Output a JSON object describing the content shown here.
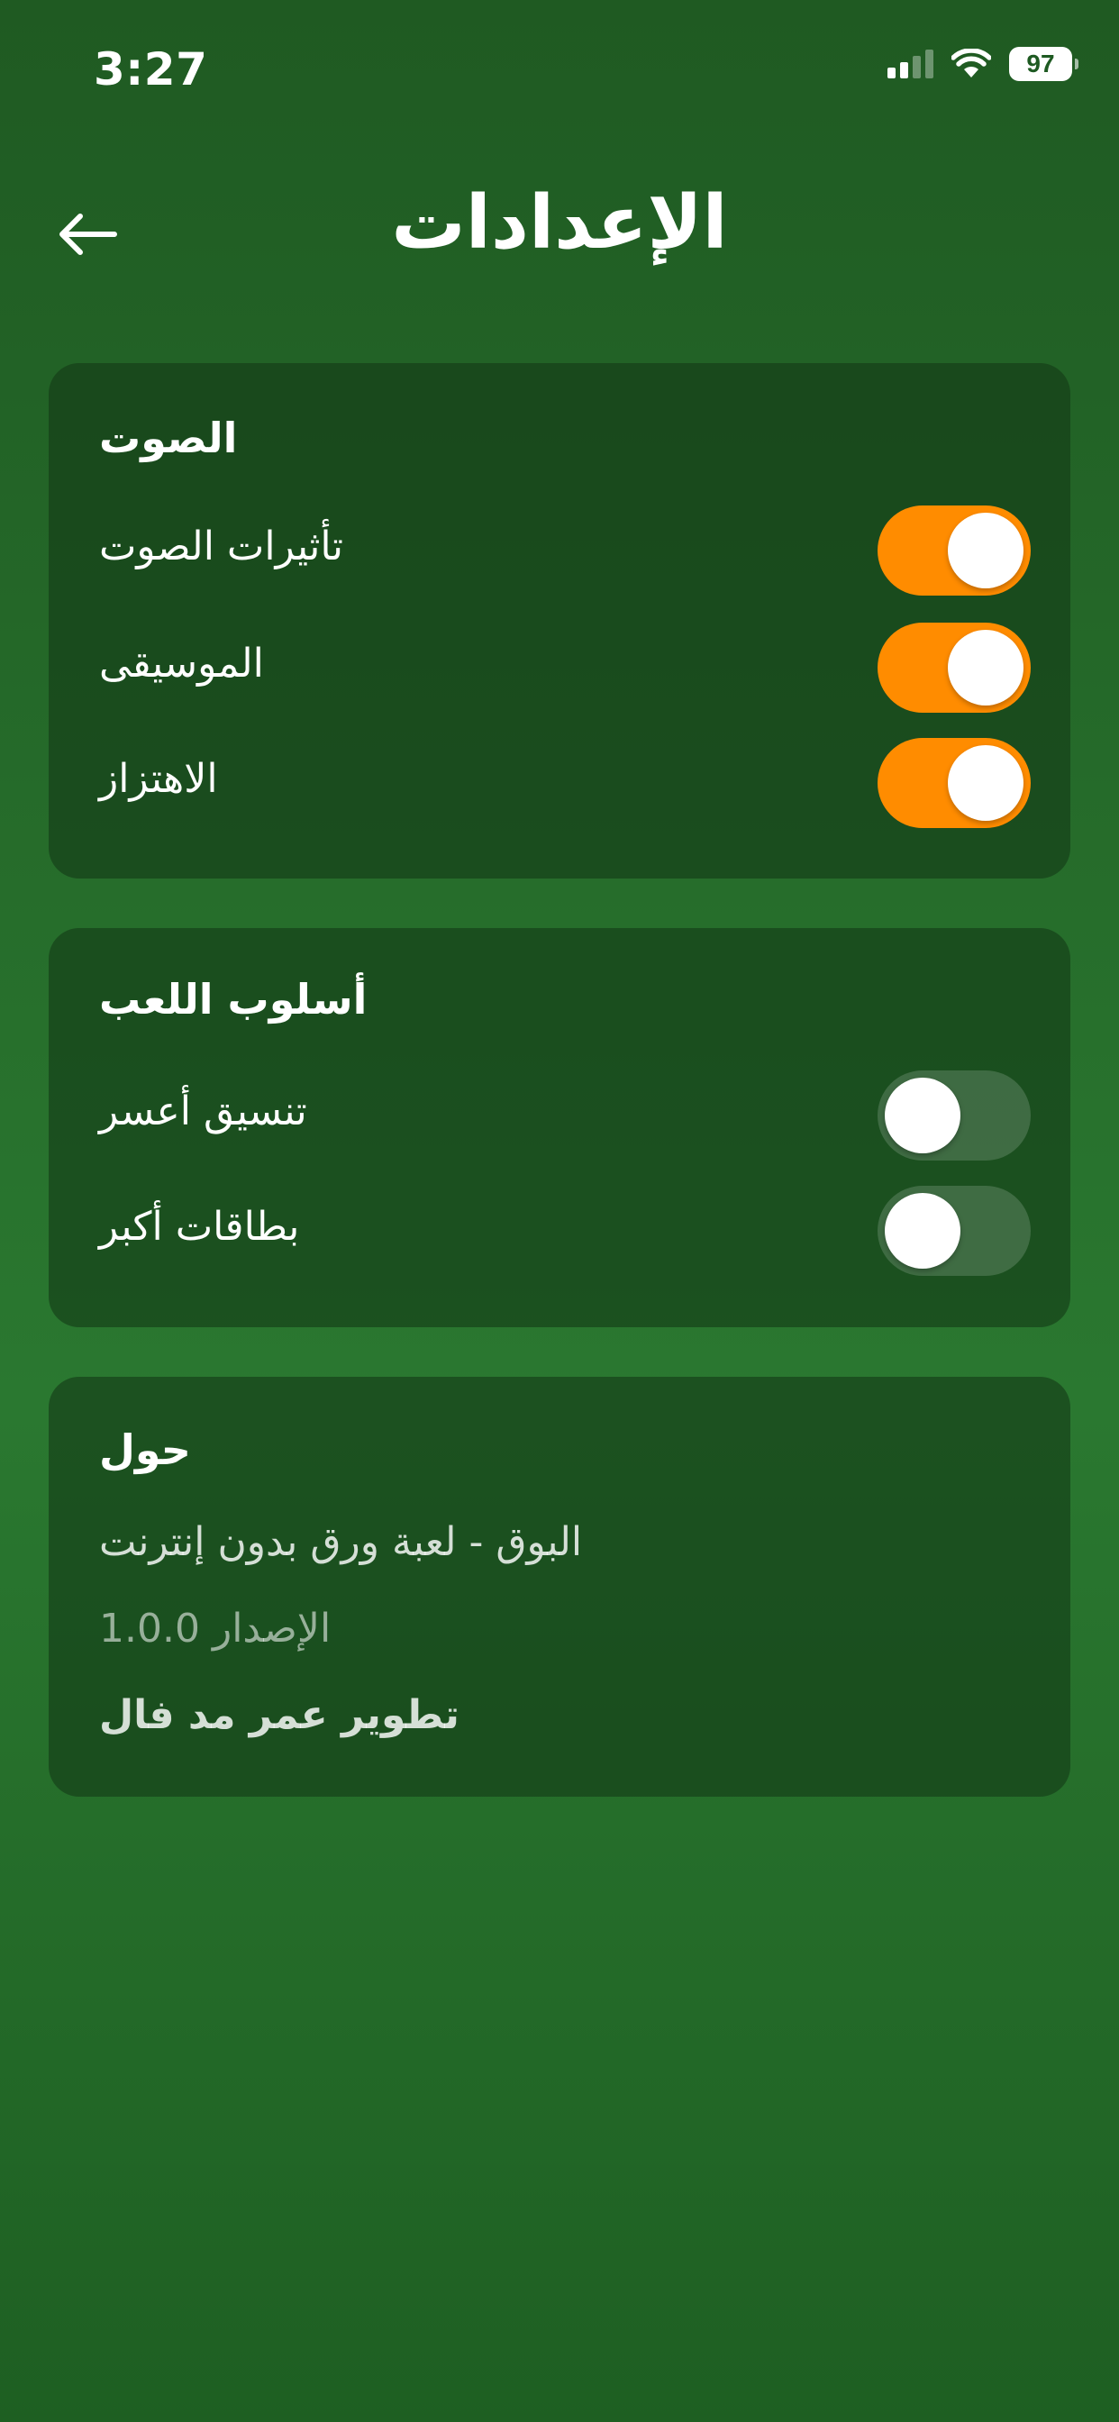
{
  "status_bar": {
    "time": "3:27",
    "battery": "97",
    "icons": [
      "signal-icon",
      "wifi-icon",
      "battery-icon"
    ]
  },
  "header": {
    "title": "الإعدادات",
    "back_icon": "arrow-left-icon"
  },
  "colors": {
    "background": "#2a7830",
    "card": "#1c4a1e",
    "toggle_on": "#ff8c00",
    "toggle_off": "#4a6a4c"
  },
  "sections": {
    "sound": {
      "title": "الصوت",
      "items": [
        {
          "label": "تأثيرات الصوت",
          "enabled": true
        },
        {
          "label": "الموسيقى",
          "enabled": true
        },
        {
          "label": "الاهتزاز",
          "enabled": true
        }
      ]
    },
    "gameplay": {
      "title": "أسلوب اللعب",
      "items": [
        {
          "label": "تنسيق أعسر",
          "enabled": false
        },
        {
          "label": "بطاقات أكبر",
          "enabled": false
        }
      ]
    },
    "about": {
      "title": "حول",
      "description": "البوق - لعبة ورق بدون إنترنت",
      "version": "الإصدار 1.0.0",
      "developer": "تطوير عمر مد فال"
    }
  }
}
